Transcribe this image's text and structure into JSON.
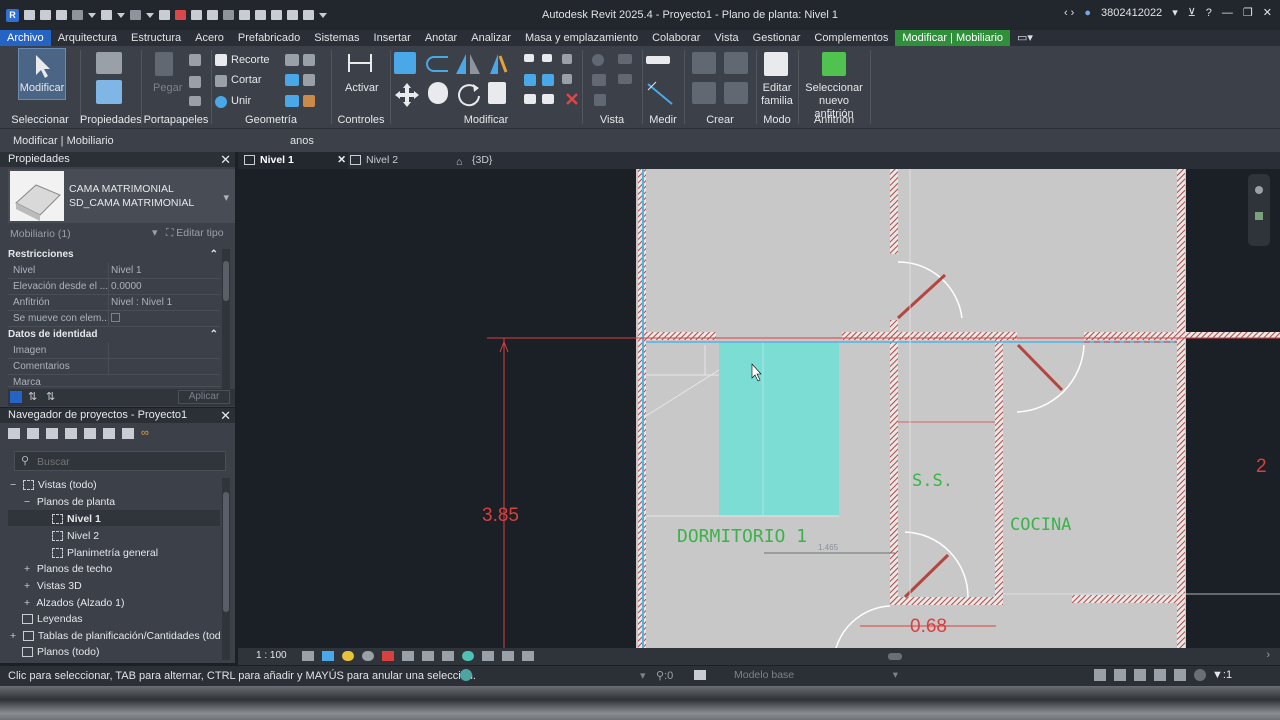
{
  "app": {
    "title": "Autodesk Revit 2025.4 - Proyecto1 - Plano de planta: Nivel 1",
    "user": "3802412022",
    "logo_letter": "R"
  },
  "tabs": [
    "Archivo",
    "Arquitectura",
    "Estructura",
    "Acero",
    "Prefabricado",
    "Sistemas",
    "Insertar",
    "Anotar",
    "Analizar",
    "Masa y emplazamiento",
    "Colaborar",
    "Vista",
    "Gestionar",
    "Complementos",
    "Modificar | Mobiliario"
  ],
  "ribbon": {
    "modificar_label": "Modificar",
    "pegar_label": "Pegar",
    "recorte_label": "Recorte",
    "cortar_label": "Cortar",
    "unir_label": "Unir",
    "activar_label": "Activar",
    "editar_familia_label": "Editar familia",
    "seleccionar_anfitrion_label": "Seleccionar nuevo anfitrión",
    "panels": {
      "seleccionar": "Seleccionar",
      "propiedades": "Propiedades",
      "portapapeles": "Portapapeles",
      "geometria": "Geometría",
      "controles": "Controles",
      "modificar": "Modificar",
      "vista": "Vista",
      "medir": "Medir",
      "crear": "Crear",
      "modo": "Modo",
      "anfitrion": "Anfitrión"
    }
  },
  "optionsbar": {
    "context": "Modificar | Mobiliario",
    "fragment": "anos"
  },
  "properties": {
    "header": "Propiedades",
    "type_name_1": "CAMA MATRIMONIAL",
    "type_name_2": "SD_CAMA MATRIMONIAL",
    "filter": "Mobiliario (1)",
    "edit_type": "Editar tipo",
    "section_restricciones": "Restricciones",
    "rows": [
      {
        "key": "Nivel",
        "value": "Nivel 1"
      },
      {
        "key": "Elevación desde el ...",
        "value": "0.0000"
      },
      {
        "key": "Anfitrión",
        "value": "Nivel : Nivel 1"
      },
      {
        "key": "Se mueve con elem...",
        "value": ""
      }
    ],
    "section_identidad": "Datos de identidad",
    "rows2": [
      {
        "key": "Imagen",
        "value": ""
      },
      {
        "key": "Comentarios",
        "value": ""
      },
      {
        "key": "Marca",
        "value": ""
      }
    ],
    "apply": "Aplicar"
  },
  "navigator": {
    "header": "Navegador de proyectos - Proyecto1",
    "search_placeholder": "Buscar",
    "items": [
      {
        "label": "Vistas (todo)",
        "sym": "−"
      },
      {
        "label": "Planos de planta",
        "sym": "−"
      },
      {
        "label": "Nivel 1",
        "sym": ""
      },
      {
        "label": "Nivel 2",
        "sym": ""
      },
      {
        "label": "Planimetría general",
        "sym": ""
      },
      {
        "label": "Planos de techo",
        "sym": "+"
      },
      {
        "label": "Vistas 3D",
        "sym": "+"
      },
      {
        "label": "Alzados (Alzado 1)",
        "sym": "+"
      },
      {
        "label": "Leyendas",
        "sym": ""
      },
      {
        "label": "Tablas de planificación/Cantidades (todo)",
        "sym": "+"
      },
      {
        "label": "Planos (todo)",
        "sym": ""
      }
    ]
  },
  "view_tabs": [
    {
      "label": "Nivel 1"
    },
    {
      "label": "Nivel 2"
    },
    {
      "label": "{3D}"
    }
  ],
  "canvas": {
    "dim_vertical": "3.85",
    "dim_door": "0.68",
    "room_dormitorio": "DORMITORIO 1",
    "room_ss": "S.S.",
    "room_cocina": "COCINA",
    "temp_dim": "1.465",
    "edge_mark": "2"
  },
  "viewbar": {
    "scale": "1 : 100"
  },
  "status": {
    "hint": "Clic para seleccionar, TAB para alternar, CTRL para añadir y MAYÚS para anular una selección.",
    "model": "Modelo base",
    "zero": ":0",
    "filter_count": ":1"
  },
  "colors": {
    "accent": "#2563c4",
    "context_tab": "#2f8f3a",
    "wall": "#c23a3a",
    "room_text": "#3bb34a",
    "bed": "#6fe0d6"
  }
}
